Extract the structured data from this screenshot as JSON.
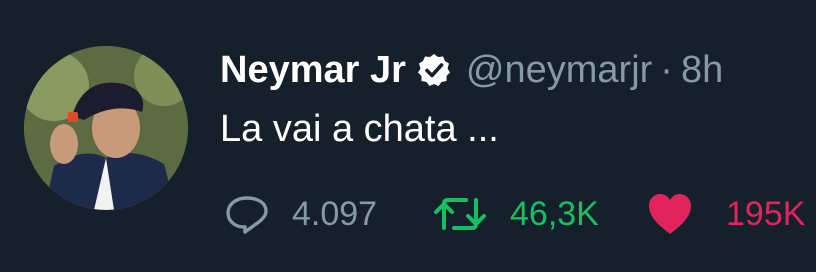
{
  "tweet": {
    "author": {
      "name": "Neymar Jr",
      "handle": "@neymarjr",
      "verified": true,
      "avatar_icon": "profile-photo"
    },
    "separator": "·",
    "timestamp": "8h",
    "text": "La vai a chata ...",
    "actions": {
      "reply": {
        "icon": "reply-icon",
        "count": "4.097",
        "color": "#8899a6"
      },
      "retweet": {
        "icon": "retweet-icon",
        "count": "46,3K",
        "color": "#17bf63"
      },
      "like": {
        "icon": "heart-icon",
        "count": "195K",
        "color": "#e0245e"
      }
    }
  },
  "colors": {
    "background": "#15202b",
    "primary_text": "#ffffff",
    "secondary_text": "#8899a6",
    "verified_badge": "#ffffff"
  }
}
